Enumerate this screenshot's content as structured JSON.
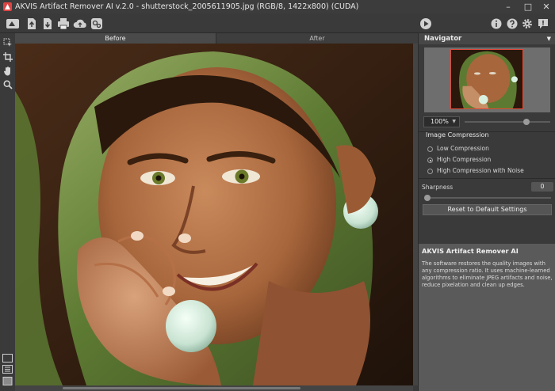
{
  "window": {
    "title": "AKVIS Artifact Remover AI v.2.0 - shutterstock_2005611905.jpg (RGB/8, 1422x800) (CUDA)",
    "minimize": "–",
    "maximize": "□",
    "close": "✕"
  },
  "toolbar": {
    "left_icons": [
      "app-logo-icon",
      "open-file-icon",
      "save-file-icon",
      "print-icon",
      "upload-cloud-icon",
      "batch-settings-icon"
    ],
    "right_icons": [
      "run-icon",
      "info-icon",
      "help-icon",
      "settings-icon",
      "news-icon"
    ]
  },
  "lefttools": [
    "crop-select-icon",
    "crop-icon",
    "hand-icon",
    "zoom-icon"
  ],
  "canvas": {
    "tabs": {
      "before": "Before",
      "after": "After"
    },
    "active_tab": "Before"
  },
  "navigator": {
    "title": "Navigator",
    "zoom": "100%",
    "zoom_slider": 0.72
  },
  "compression": {
    "title": "Image Compression",
    "options": [
      "Low Compression",
      "High Compression",
      "High Compression with Noise"
    ],
    "selected": "High Compression"
  },
  "sharpness": {
    "label": "Sharpness",
    "value": "0",
    "level": 0
  },
  "buttons": {
    "reset": "Reset to Default Settings"
  },
  "info": {
    "title": "AKVIS Artifact Remover AI",
    "text": "The software restores the quality images with any compression ratio. It uses machine-learned algorithms to eliminate JPEG artifacts and noise, reduce pixelation and clean up edges."
  },
  "colors": {
    "panel_bg": "#3a3a3a",
    "info_bg": "#5a5a5a",
    "navigator_frame": "#e04a3a"
  }
}
